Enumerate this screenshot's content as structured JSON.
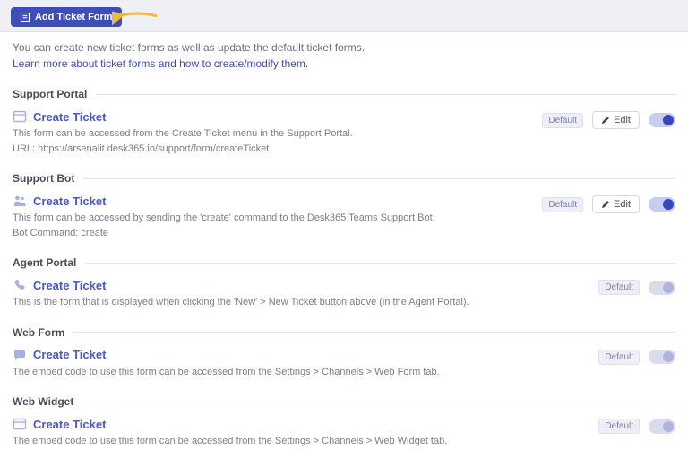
{
  "header": {
    "add_button_label": "Add Ticket Form"
  },
  "intro": {
    "line1": "You can create new ticket forms as well as update the default ticket forms.",
    "link_text": "Learn more about ticket forms and how to create/modify them."
  },
  "badges": {
    "default_label": "Default",
    "edit_label": "Edit"
  },
  "sections": [
    {
      "title": "Support Portal",
      "item": {
        "icon": "window",
        "name": "Create Ticket",
        "desc": "This form can be accessed from the Create Ticket menu in the Support Portal.",
        "sub_prefix": "URL: ",
        "sub_value": "https://arsenalit.desk365.io/support/form/createTicket",
        "show_edit": true,
        "toggle_on": true
      }
    },
    {
      "title": "Support Bot",
      "item": {
        "icon": "teams",
        "name": "Create Ticket",
        "desc": "This form can be accessed by sending the 'create' command to the Desk365 Teams Support Bot.",
        "sub_prefix": "Bot Command: ",
        "sub_value": "create",
        "show_edit": true,
        "toggle_on": true
      }
    },
    {
      "title": "Agent Portal",
      "item": {
        "icon": "phone",
        "name": "Create Ticket",
        "desc": "This is the form that is displayed when clicking the 'New' > New Ticket button above (in the Agent Portal).",
        "sub_prefix": "",
        "sub_value": "",
        "show_edit": false,
        "toggle_on": false
      }
    },
    {
      "title": "Web Form",
      "item": {
        "icon": "chat",
        "name": "Create Ticket",
        "desc": "The embed code to use this form can be accessed from the Settings > Channels > Web Form tab.",
        "sub_prefix": "",
        "sub_value": "",
        "show_edit": false,
        "toggle_on": false
      }
    },
    {
      "title": "Web Widget",
      "item": {
        "icon": "window",
        "name": "Create Ticket",
        "desc": "The embed code to use this form can be accessed from the Settings > Channels > Web Widget tab.",
        "sub_prefix": "",
        "sub_value": "",
        "show_edit": false,
        "toggle_on": false
      }
    }
  ]
}
